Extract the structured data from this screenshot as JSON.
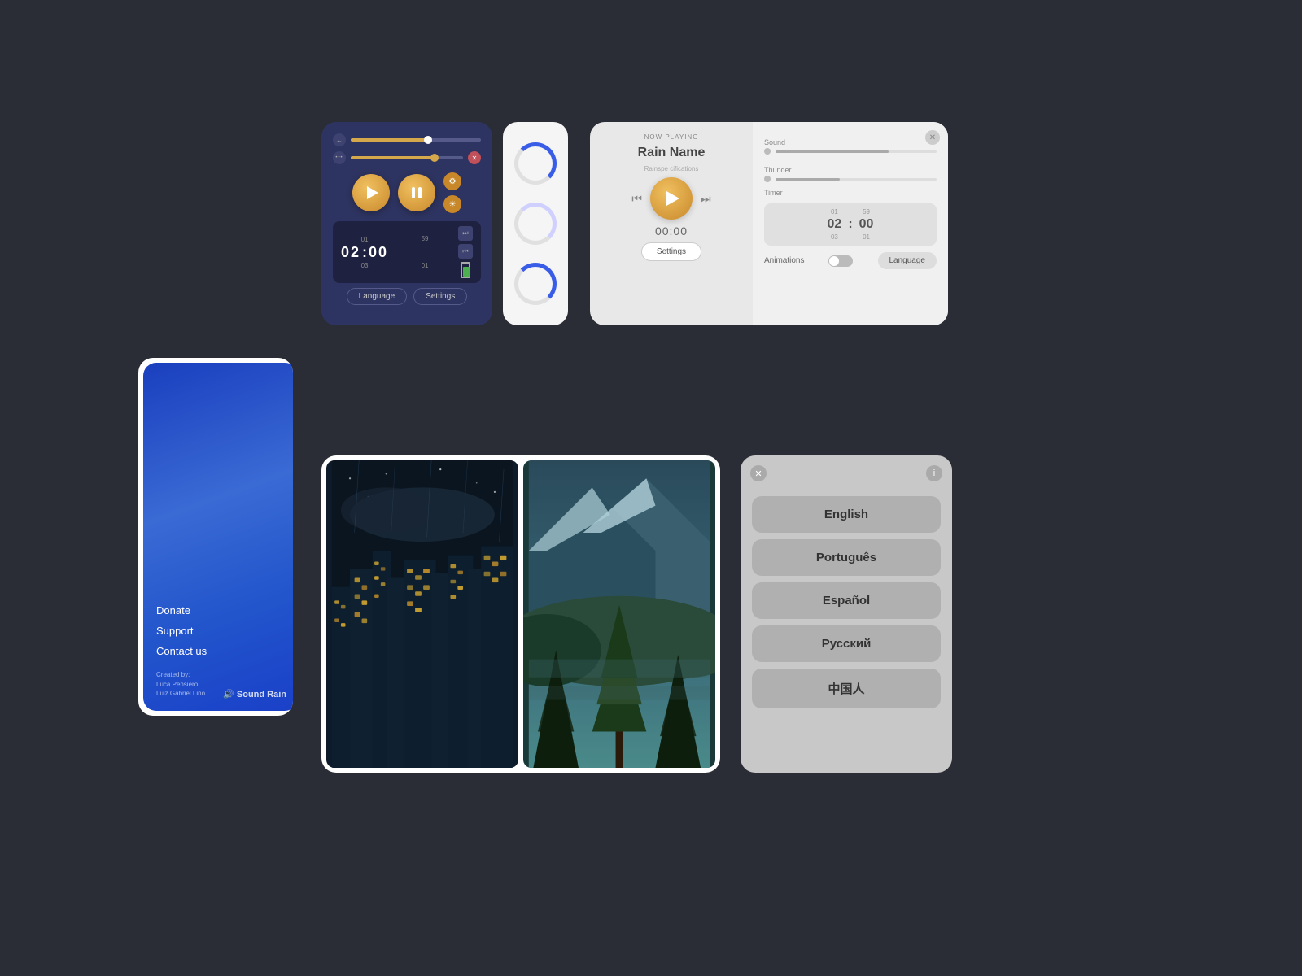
{
  "player": {
    "slider1_fill": "60%",
    "slider2_fill": "75%",
    "time_display": "02 : 00",
    "time_top": "01",
    "time_right": "59",
    "time_bottom": "03",
    "time_bottom_right": "01",
    "language_btn": "Language",
    "settings_btn": "Settings",
    "back_icon": "←",
    "dots_icon": "•••",
    "close_icon": "✕",
    "gear_icon": "⚙",
    "sun_icon": "☀"
  },
  "main_player": {
    "now_playing": "NOW PLAYING",
    "rain_name": "Rain Name",
    "rain_sub": "Rainspe cifications",
    "timer": "00:00",
    "settings_btn": "Settings",
    "sound_label": "Sound",
    "thunder_label": "Thunder",
    "timer_label": "Timer",
    "timer_display": "02 : 00",
    "timer_top": "01",
    "timer_right": "59",
    "timer_bottom": "03",
    "timer_bottom_right": "01",
    "animations_label": "Animations",
    "language_btn": "Language"
  },
  "about": {
    "donate": "Donate",
    "support": "Support",
    "contact": "Contact us",
    "created_by": "Created by:",
    "author1": "Luca Pensiero",
    "author2": "Luiz Gabriel Lino",
    "logo": "🔊 Sound Rain"
  },
  "language_selector": {
    "languages": [
      "English",
      "Português",
      "Español",
      "Русский",
      "中国人"
    ],
    "close_icon": "✕",
    "info_icon": "i"
  }
}
